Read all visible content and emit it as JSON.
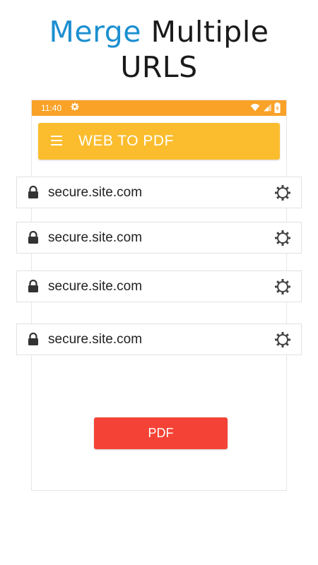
{
  "promo": {
    "line1_accent": "Merge",
    "line1_rest": " Multiple",
    "line2": "URLS"
  },
  "statusbar": {
    "time": "11:40",
    "icons": [
      "settings-icon",
      "wifi-icon",
      "signal-icon",
      "battery-icon"
    ]
  },
  "appbar": {
    "menu_icon": "menu-icon",
    "title": "WEB TO PDF"
  },
  "url_rows": [
    {
      "url": "secure.site.com",
      "icon_left": "lock-icon",
      "icon_right": "settings-icon"
    },
    {
      "url": "secure.site.com",
      "icon_left": "lock-icon",
      "icon_right": "settings-icon"
    },
    {
      "url": "secure.site.com",
      "icon_left": "lock-icon",
      "icon_right": "settings-icon"
    },
    {
      "url": "secure.site.com",
      "icon_left": "lock-icon",
      "icon_right": "settings-icon"
    }
  ],
  "actions": {
    "pdf_label": "PDF"
  },
  "colors": {
    "accent_blue": "#1b8fd0",
    "statusbar": "#f9a227",
    "appbar": "#fbbd2e",
    "pdf_button": "#f44336"
  }
}
